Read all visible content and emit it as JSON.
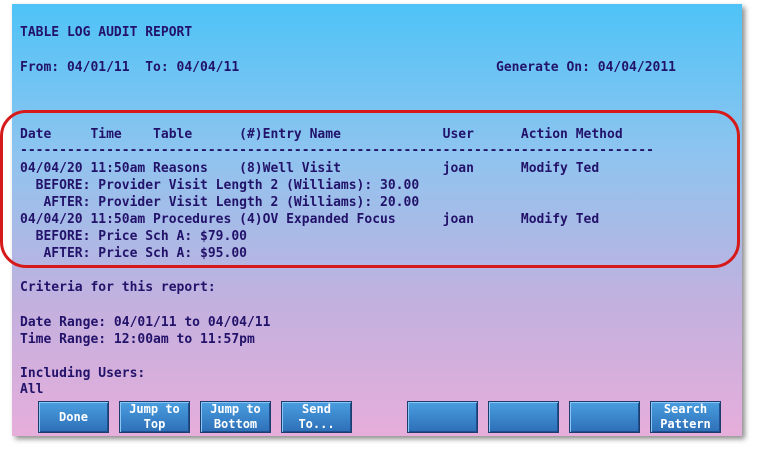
{
  "report": {
    "title": "TABLE LOG AUDIT REPORT",
    "range_line": "From: 04/01/11  To: 04/04/11",
    "generated_line": "Generate On: 04/04/2011"
  },
  "table": {
    "header": "Date     Time    Table      (#)Entry Name             User      Action Method",
    "separator": "---------------------------------------------------------------------------------",
    "lines": [
      "04/04/20 11:50am Reasons    (8)Well Visit             joan      Modify Ted",
      "  BEFORE: Provider Visit Length 2 (Williams): 30.00",
      "   AFTER: Provider Visit Length 2 (Williams): 20.00",
      "04/04/20 11:50am Procedures (4)OV Expanded Focus      joan      Modify Ted",
      "  BEFORE: Price Sch A: $79.00",
      "   AFTER: Price Sch A: $95.00"
    ]
  },
  "criteria": {
    "heading": "Criteria for this report:",
    "date_range": "Date Range: 04/01/11 to 04/04/11",
    "time_range": "Time Range: 12:00am to 11:57pm",
    "users_heading": "Including Users:",
    "users_value": "All"
  },
  "function_keys": [
    "Done",
    "Jump to\nTop",
    "Jump to\nBottom",
    "Send\nTo...",
    "",
    "",
    "",
    "Search\nPattern"
  ],
  "colors": {
    "text": "#22126a",
    "highlight_border": "#d61a1a",
    "button": "#2d6fb8"
  }
}
